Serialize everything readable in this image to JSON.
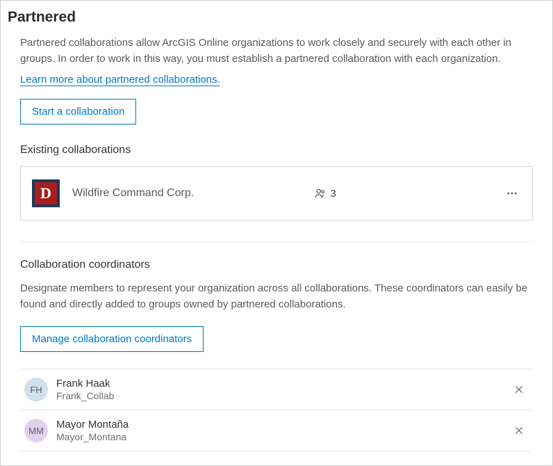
{
  "page": {
    "title": "Partnered",
    "intro": "Partnered collaborations allow ArcGIS Online organizations to work closely and securely with each other in groups. In order to work in this way, you must establish a partnered collaboration with each organization.",
    "learn_link": "Learn more about partnered collaborations.",
    "start_button": "Start a collaboration"
  },
  "existing": {
    "heading": "Existing collaborations",
    "items": [
      {
        "name": "Wildfire Command Corp.",
        "member_count": "3"
      }
    ]
  },
  "coordinators": {
    "heading": "Collaboration coordinators",
    "description": "Designate members to represent your organization across all collaborations. These coordinators can easily be found and directly added to groups owned by partnered collaborations.",
    "manage_button": "Manage collaboration coordinators",
    "members": [
      {
        "initials": "FH",
        "name": "Frank Haak",
        "username": "Frank_Collab",
        "avatar_class": "avatar-blue"
      },
      {
        "initials": "MM",
        "name": "Mayor Montaña",
        "username": "Mayor_Montana",
        "avatar_class": "avatar-purple"
      }
    ]
  }
}
